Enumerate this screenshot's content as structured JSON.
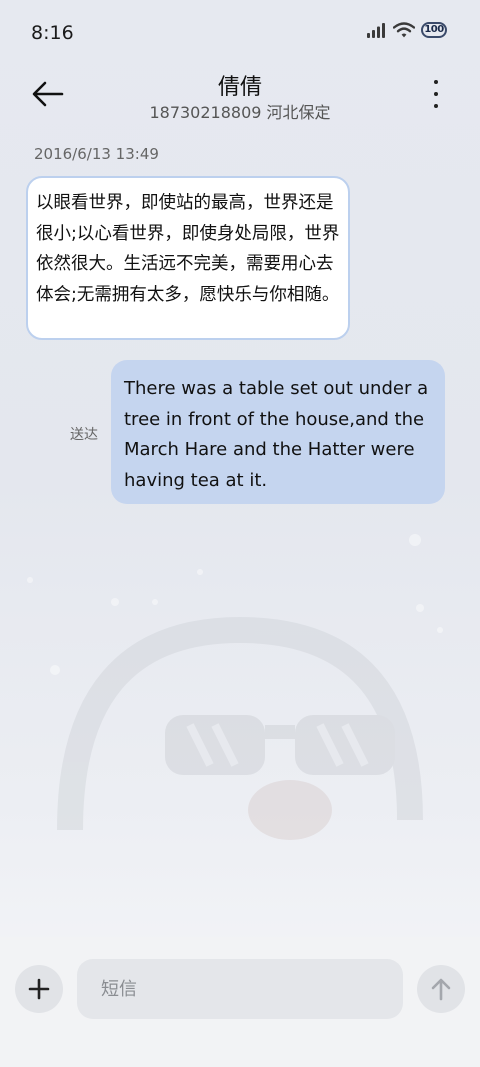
{
  "status_bar": {
    "time": "8:16",
    "battery": "100",
    "icons": [
      "signal-icon",
      "wifi-icon",
      "battery-icon"
    ]
  },
  "header": {
    "contact_name": "倩倩",
    "contact_info": "18730218809 河北保定",
    "icons": [
      "back-arrow-icon",
      "more-vertical-icon"
    ]
  },
  "conversation": {
    "timestamp": "2016/6/13 13:49",
    "messages": [
      {
        "direction": "incoming",
        "text": "以眼看世界，即使站的最高，世界还是很小;以心看世界，即使身处局限，世界依然很大。生活远不完美，需要用心去体会;无需拥有太多，愿快乐与你相随。"
      },
      {
        "direction": "outgoing",
        "text": "There was a table set out under a tree in front of the house,and the March Hare and the Hatter were having tea at it.",
        "status": "送达"
      }
    ]
  },
  "composer": {
    "placeholder": "短信",
    "value": "",
    "icons": [
      "plus-icon",
      "send-arrow-icon"
    ]
  },
  "colors": {
    "incoming_bubble_bg": "#ffffff",
    "incoming_bubble_border": "#bcd0ee",
    "outgoing_bubble_bg": "#c5d5ef",
    "background": "#e6e9f0",
    "composer_bg": "#f2f3f5"
  }
}
